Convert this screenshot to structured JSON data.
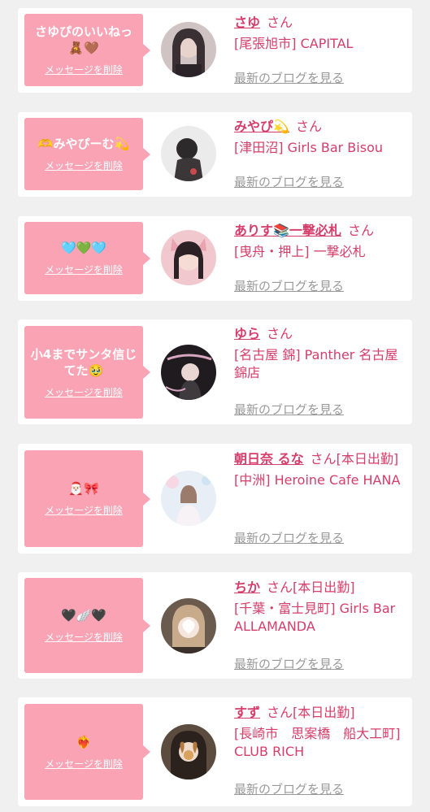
{
  "delete_label": "メッセージを削除",
  "blog_label": "最新のブログを見る",
  "accent_color": "#d63d6a",
  "bubble_color": "#f9a3b4",
  "cards": [
    {
      "message": "さゆぴのいいねっ🧸🤎",
      "name": "さゆ",
      "suffix": "さん",
      "shop": "[尾張旭市] CAPITAL"
    },
    {
      "message": "🫶みやぴーむ💫",
      "name": "みやぴ💫",
      "suffix": "さん",
      "shop": "[津田沼] Girls Bar Bisou"
    },
    {
      "message": "🩵💚🩵",
      "name": "ありす📚一撃必札",
      "suffix": "さん",
      "shop": "[曳舟・押上] 一撃必札"
    },
    {
      "message": "小4までサンタ信じてた🥹",
      "name": "ゆら",
      "suffix": "さん",
      "shop": "[名古屋 錦] Panther 名古屋錦店"
    },
    {
      "message": "🎅🏻🎀",
      "name": "朝日奈 るな",
      "suffix": "さん[本日出勤]",
      "shop": "[中洲] Heroine Cafe HANA"
    },
    {
      "message": "🖤🪽🖤",
      "name": "ちか",
      "suffix": "さん[本日出勤]",
      "shop": "[千葉・富士見町] Girls Bar ALLAMANDA"
    },
    {
      "message": "❤️‍🔥",
      "name": "すず",
      "suffix": "さん[本日出勤]",
      "shop": "[長崎市　思案橋　船大工町] CLUB RICH"
    }
  ]
}
